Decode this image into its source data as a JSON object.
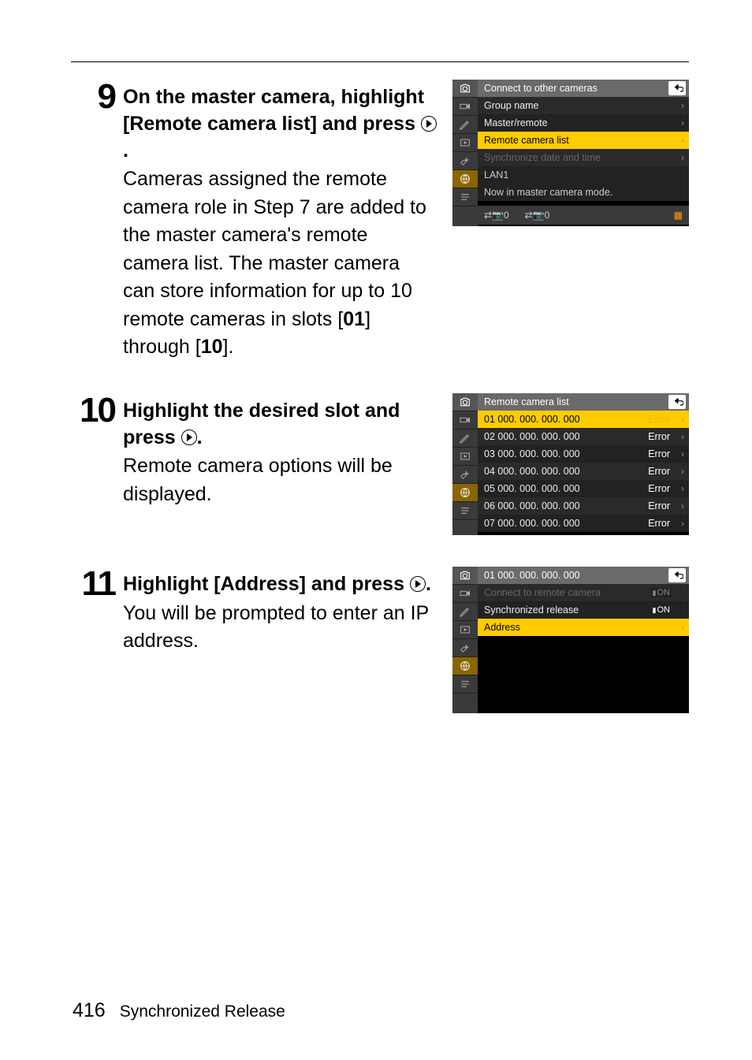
{
  "steps": {
    "s9": {
      "num": "9",
      "heading_a": "On the master camera, highlight [Remote camera list] and press ",
      "heading_b": ".",
      "desc_a": "Cameras assigned the remote camera role in Step 7 are added to the master camera's remote camera list. The master camera can store information for up to 10 remote cameras in slots [",
      "desc_b": "] through [",
      "desc_c": "].",
      "slot_a": "01",
      "slot_b": "10"
    },
    "s10": {
      "num": "10",
      "heading_a": "Highlight the desired slot and press ",
      "heading_b": ".",
      "desc": "Remote camera options will be displayed."
    },
    "s11": {
      "num": "11",
      "heading_a": "Highlight [Address] and press ",
      "heading_b": ".",
      "desc": "You will be prompted to enter an IP address."
    }
  },
  "shot9": {
    "r1": "Connect to other cameras",
    "r2": "Group name",
    "r3": "Master/remote",
    "r4": "Remote camera list",
    "r5": "Synchronize date and time",
    "r6": "LAN1",
    "r7": "Now in master camera mode.",
    "b1": "⇄📷0",
    "b2": "⇄📷0"
  },
  "shot10": {
    "title": "Remote camera list",
    "rows": [
      {
        "idx": "01",
        "ip": " 000. 000. 000. 000",
        "err": "Error"
      },
      {
        "idx": "02",
        "ip": " 000. 000. 000. 000",
        "err": "Error"
      },
      {
        "idx": "03",
        "ip": " 000. 000. 000. 000",
        "err": "Error"
      },
      {
        "idx": "04",
        "ip": " 000. 000. 000. 000",
        "err": "Error"
      },
      {
        "idx": "05",
        "ip": " 000. 000. 000. 000",
        "err": "Error"
      },
      {
        "idx": "06",
        "ip": " 000. 000. 000. 000",
        "err": "Error"
      },
      {
        "idx": "07",
        "ip": " 000. 000. 000. 000",
        "err": "Error"
      }
    ]
  },
  "shot11": {
    "title": "01  000. 000. 000. 000",
    "r2": "Connect to remote camera",
    "r3": "Synchronized release",
    "r4": "Address",
    "on": "ON"
  },
  "footer": {
    "page": "416",
    "label": "Synchronized Release"
  }
}
